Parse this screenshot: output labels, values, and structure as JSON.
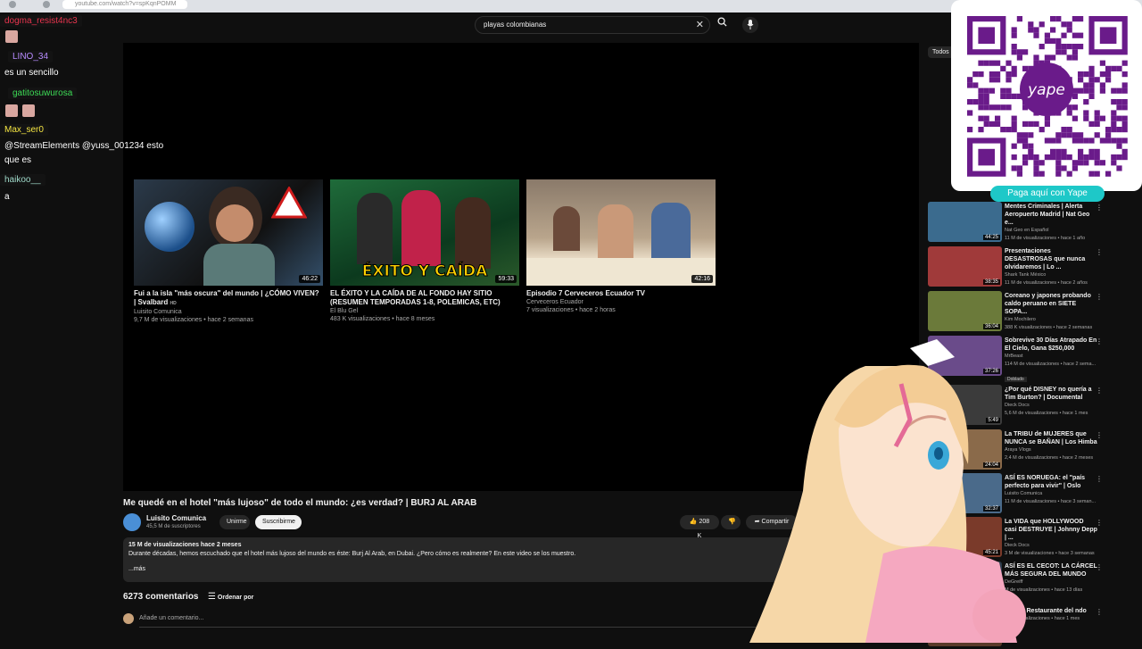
{
  "browser": {
    "url": "youtube.com/watch?v=spKqnPOMM"
  },
  "search": {
    "query": "playas colombianas"
  },
  "endcards": [
    {
      "title": "Fui a la isla \"más oscura\" del mundo | ¿CÓMO VIVEN? | Svalbard",
      "hd": "HD",
      "channel": "Luisito Comunica",
      "meta": "9,7 M de visualizaciones • hace 2 semanas",
      "duration": "46:22"
    },
    {
      "title": "EL ÉXITO Y LA CAÍDA DE AL FONDO HAY SITIO (RESUMEN TEMPORADAS 1-8, POLEMICAS, ETC)",
      "channel": "El Blu Gel",
      "meta": "483 K visualizaciones • hace 8 meses",
      "duration": "59:33",
      "overlay": "ÉXITO Y CAÍDA"
    },
    {
      "title": "Episodio 7 Cerveceros Ecuador TV",
      "channel": "Cerveceros Ecuador",
      "meta": "7 visualizaciones • hace 2 horas",
      "duration": "42:16"
    }
  ],
  "video": {
    "title": "Me quedé en el hotel \"más lujoso\" de todo el mundo: ¿es verdad? | BURJ AL ARAB",
    "channel": "Luisito Comunica",
    "subscribers": "45,5 M de suscriptores",
    "join": "Unirme",
    "subscribe": "Suscribirme",
    "likes": "208 K",
    "share": "Compartir",
    "desc_meta": "15 M de visualizaciones  hace 2 meses",
    "desc_text": "Durante décadas, hemos escuchado que el hotel más lujoso del mundo es éste: Burj Al Arab, en Dubai. ¿Pero cómo es realmente? En este video se los muestro.",
    "more": "...más",
    "comments": "6273 comentarios",
    "sort": "Ordenar por",
    "add_comment": "Añade un comentario..."
  },
  "chat": [
    {
      "user": "dogma_resist4nc3",
      "color": "#e8344e"
    },
    {
      "user": "LINO_34",
      "color": "#b88cff",
      "msg": "es un sencillo"
    },
    {
      "user": "gatitosuwurosa",
      "color": "#3ddc56"
    },
    {
      "user": "Max_ser0",
      "color": "#f5e642",
      "msg": "@StreamElements @yuss_001234 esto",
      "msg2": "que es"
    },
    {
      "user": "haikoo__",
      "color": "#9ed8c8",
      "msg": "a"
    }
  ],
  "sidebar": {
    "chip": "Todos",
    "items": [
      {
        "title": "Mentes Criminales | Alerta Aeropuerto Madrid | Nat Geo e...",
        "channel": "Nat Geo en Español",
        "meta": "11 M de visualizaciones • hace 1 año",
        "duration": "44:25"
      },
      {
        "title": "Presentaciones DESASTROSAS que nunca olvidaremos | Lo ...",
        "channel": "Shark Tank México",
        "meta": "11 M de visualizaciones • hace 2 años",
        "duration": "38:35"
      },
      {
        "title": "Coreano y japones probando caldo peruano en SIETE SOPA...",
        "channel": "Kim Mochilero",
        "meta": "388 K visualizaciones • hace 2 semanas",
        "duration": "36:04"
      },
      {
        "title": "Sobrevive 30 Días Atrapado En El Cielo, Gana $250,000",
        "channel": "MrBeast",
        "meta": "114 M de visualizaciones • hace 2 sema...",
        "duration": "37:26",
        "badge": "Doblado"
      },
      {
        "title": "¿Por qué DISNEY no quería a Tim Burton? | Documental",
        "channel": "Dieck Docs",
        "meta": "5,6 M de visualizaciones • hace 1 mes",
        "duration": "5:49"
      },
      {
        "title": "La TRIBU de MUJERES que NUNCA se BAÑAN | Los Himba",
        "channel": "Araya Vlogs",
        "meta": "2,4 M de visualizaciones • hace 2 meses",
        "duration": "24:04"
      },
      {
        "title": "ASÍ ES NORUEGA: el \"país perfecto para vivir\" | Oslo",
        "channel": "Luisito Comunica",
        "meta": "11 M de visualizaciones • hace 3 seman...",
        "duration": "32:37"
      },
      {
        "title": "La VIDA que HOLLYWOOD casi DESTRUYE | Johnny Depp | ...",
        "channel": "Dieck Docs",
        "meta": "3 M de visualizaciones • hace 3 semanas",
        "duration": "45:21"
      },
      {
        "title": "ASÍ ES EL CECOT: LA CÁRCEL MÁS SEGURA DEL MUNDO",
        "channel": "DeGreiff",
        "meta": "M de visualizaciones • hace 13 días",
        "duration": ""
      },
      {
        "title": "l Mejor Restaurante del ndo",
        "channel": "",
        "meta": "M de visualizaciones • hace 1 mes",
        "duration": ""
      }
    ]
  },
  "donation": {
    "label": "Paga aquí con Yape",
    "brand": "yape"
  },
  "colors": {
    "bg": "#0f0f0f",
    "yape": "#1ec8c8",
    "qr": "#6a1b8a"
  }
}
